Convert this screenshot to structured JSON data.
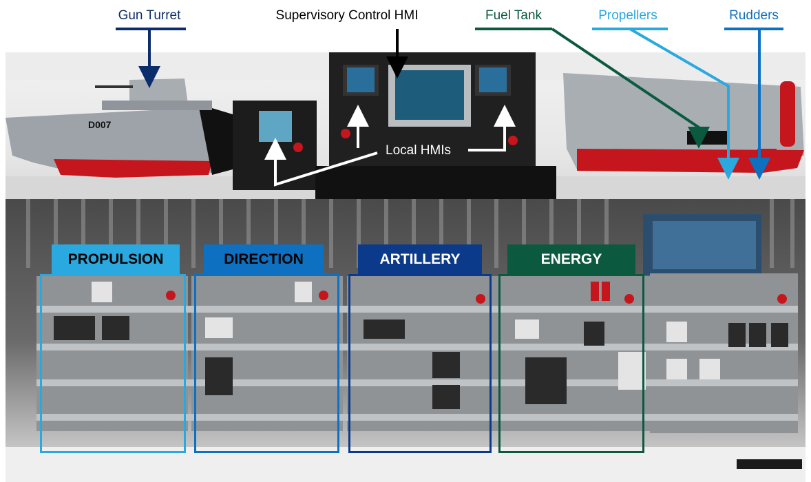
{
  "top_labels": {
    "gun_turret": "Gun Turret",
    "supervisory_hmi": "Supervisory Control HMI",
    "fuel_tank": "Fuel Tank",
    "propellers": "Propellers",
    "rudders": "Rudders"
  },
  "callouts": {
    "local_hmis": "Local HMIs",
    "ship_id": "D007"
  },
  "sections": [
    {
      "label": "PROPULSION",
      "color": "#29a9e0",
      "text_color": "#000000"
    },
    {
      "label": "DIRECTION",
      "color": "#0e70c0",
      "text_color": "#000000"
    },
    {
      "label": "ARTILLERY",
      "color": "#0b3a8a",
      "text_color": "#ffffff"
    },
    {
      "label": "ENERGY",
      "color": "#0b5a3f",
      "text_color": "#ffffff"
    }
  ],
  "colors": {
    "gun_turret": "#0b2d6b",
    "supervisory_hmi": "#000000",
    "fuel_tank": "#0b5a3f",
    "propellers": "#2aa8e0",
    "rudders": "#0e70c0"
  }
}
